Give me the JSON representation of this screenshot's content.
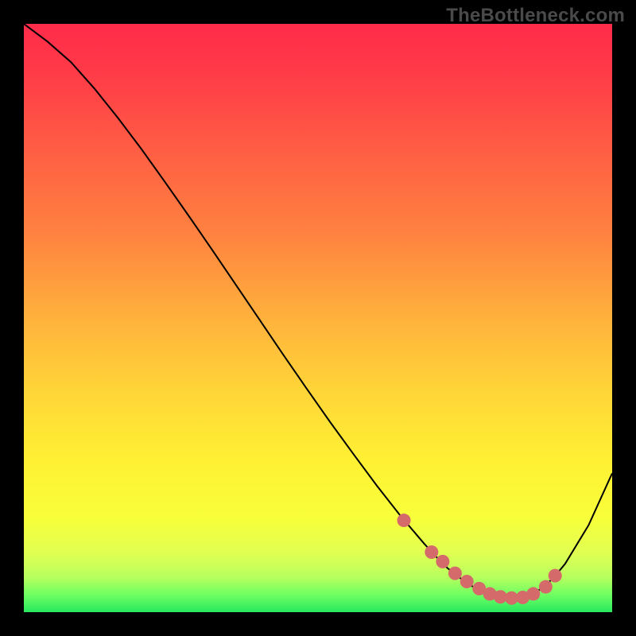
{
  "watermark": {
    "text": "TheBottleneck.com"
  },
  "colors": {
    "background": "#000000",
    "gradient_stops": [
      {
        "offset": 0.0,
        "color": "#ff2b4a"
      },
      {
        "offset": 0.08,
        "color": "#ff3a48"
      },
      {
        "offset": 0.2,
        "color": "#ff5a44"
      },
      {
        "offset": 0.35,
        "color": "#ff8040"
      },
      {
        "offset": 0.5,
        "color": "#ffb13c"
      },
      {
        "offset": 0.62,
        "color": "#ffd438"
      },
      {
        "offset": 0.74,
        "color": "#fff033"
      },
      {
        "offset": 0.84,
        "color": "#f8ff3a"
      },
      {
        "offset": 0.9,
        "color": "#e0ff52"
      },
      {
        "offset": 0.94,
        "color": "#b8ff5e"
      },
      {
        "offset": 0.97,
        "color": "#70ff62"
      },
      {
        "offset": 1.0,
        "color": "#28e860"
      }
    ],
    "curve": "#000000",
    "markers": "#d56a6a"
  },
  "chart_data": {
    "type": "line",
    "title": "",
    "xlabel": "",
    "ylabel": "",
    "xlim": [
      0,
      100
    ],
    "ylim": [
      0,
      100
    ],
    "grid": false,
    "x": [
      0,
      4,
      8,
      12,
      16,
      20,
      24,
      28,
      32,
      36,
      40,
      44,
      48,
      52,
      56,
      60,
      64,
      68,
      70,
      72,
      74,
      76,
      78,
      80,
      82,
      84,
      86,
      88,
      90,
      92,
      96,
      100
    ],
    "values": [
      100,
      97,
      93.5,
      89,
      84,
      78.7,
      73.1,
      67.4,
      61.6,
      55.7,
      49.8,
      43.9,
      38.1,
      32.4,
      26.9,
      21.5,
      16.4,
      11.7,
      9.5,
      7.5,
      5.9,
      4.5,
      3.5,
      2.8,
      2.4,
      2.4,
      2.9,
      4.0,
      5.8,
      8.2,
      14.8,
      23.6
    ],
    "marker_x": [
      64.6,
      69.3,
      71.2,
      73.3,
      75.3,
      77.4,
      79.2,
      81.0,
      82.9,
      84.8,
      86.6,
      88.7,
      90.3
    ],
    "marker_y": [
      15.6,
      10.2,
      8.6,
      6.6,
      5.2,
      4.0,
      3.1,
      2.6,
      2.4,
      2.5,
      3.1,
      4.3,
      6.2
    ],
    "annotations": []
  }
}
